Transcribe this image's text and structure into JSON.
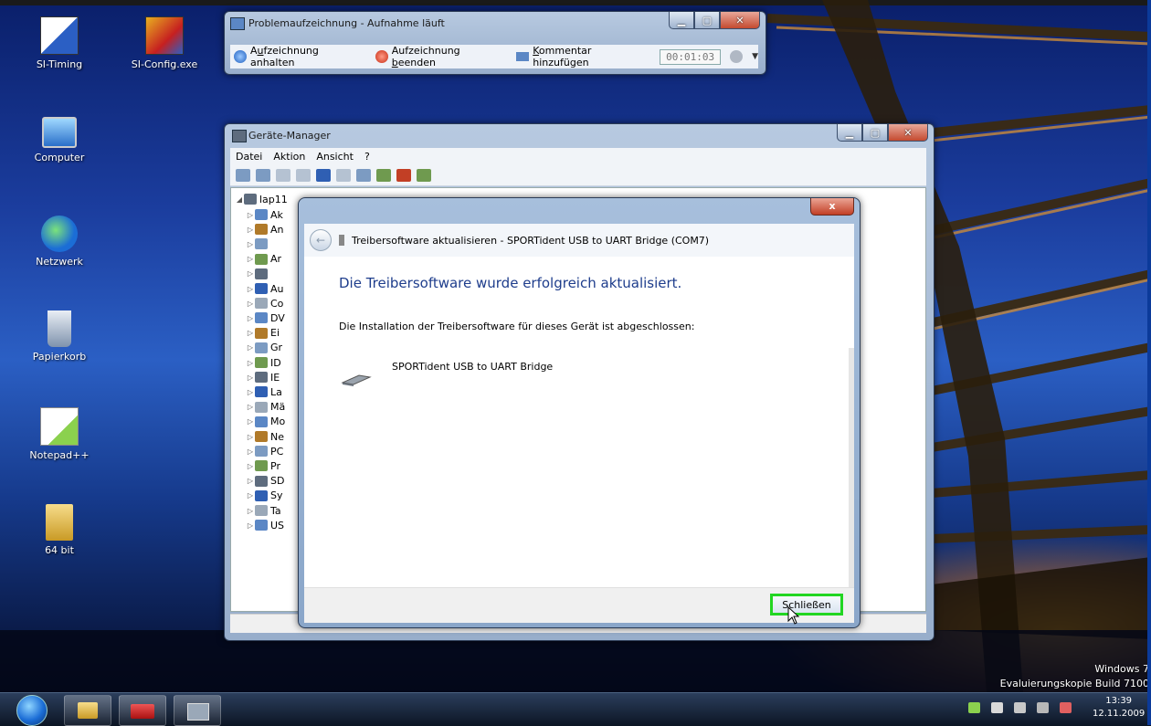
{
  "desktop": {
    "icons": [
      {
        "label": "SI-Timing",
        "icon": "si-timing-icon"
      },
      {
        "label": "SI-Config.exe",
        "icon": "si-config-icon"
      },
      {
        "label": "Computer",
        "icon": "computer-icon"
      },
      {
        "label": "Netzwerk",
        "icon": "network-icon"
      },
      {
        "label": "Papierkorb",
        "icon": "recycle-bin-icon"
      },
      {
        "label": "Notepad++",
        "icon": "notepad-icon"
      },
      {
        "label": "64 bit",
        "icon": "folder-icon"
      }
    ],
    "watermark_line1": "Windows 7",
    "watermark_line2": "Evaluierungskopie Build 7100"
  },
  "recorder": {
    "title": "Problemaufzeichnung - Aufnahme läuft",
    "pause_label_pre": "A",
    "pause_label_u": "u",
    "pause_label_post": "fzeichnung anhalten",
    "stop_label_pre": "Aufzeichnung ",
    "stop_label_u": "b",
    "stop_label_post": "eenden",
    "comment_label_pre": "",
    "comment_label_u": "K",
    "comment_label_post": "ommentar hinzufügen",
    "timer": "00:01:03"
  },
  "device_manager": {
    "title": "Geräte-Manager",
    "menu": [
      "Datei",
      "Aktion",
      "Ansicht",
      "?"
    ],
    "tree_root": "lap11",
    "tree_items": [
      "Ak",
      "An",
      "",
      "Ar",
      "",
      "Au",
      "Co",
      "DV",
      "Ei",
      "Gr",
      "ID",
      "IE",
      "La",
      "Mä",
      "Mo",
      "Ne",
      "PC",
      "Pr",
      "SD",
      "Sy",
      "Ta",
      "US"
    ]
  },
  "wizard": {
    "title": "Treibersoftware aktualisieren - SPORTident USB to UART Bridge (COM7)",
    "close_glyph": "x",
    "headline": "Die Treibersoftware wurde erfolgreich aktualisiert.",
    "info": "Die Installation der Treibersoftware für dieses Gerät ist abgeschlossen:",
    "device_name": "SPORTident USB to UART Bridge",
    "close_button": "Schließen"
  },
  "taskbar": {
    "time": "13:39",
    "date": "12.11.2009"
  },
  "colors": {
    "accent": "#22d622",
    "headline": "#1e3d8c"
  }
}
